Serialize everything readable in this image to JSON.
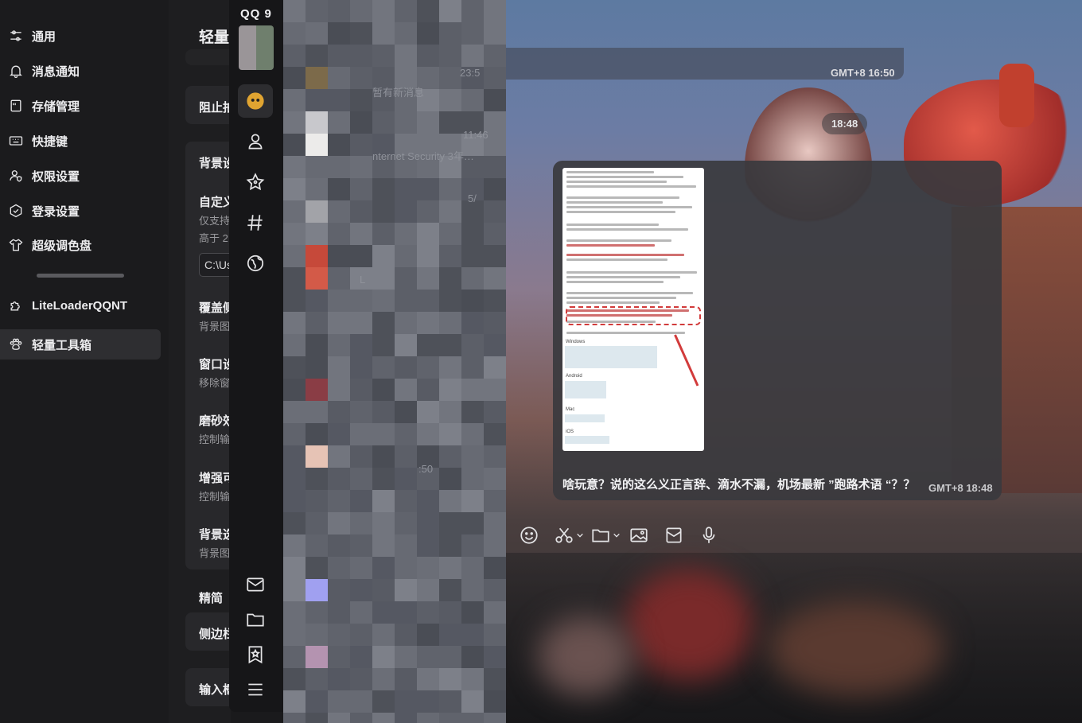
{
  "settings_nav": {
    "items": [
      {
        "label": "通用",
        "icon": "sliders-icon"
      },
      {
        "label": "消息通知",
        "icon": "bell-icon"
      },
      {
        "label": "存储管理",
        "icon": "storage-icon"
      },
      {
        "label": "快捷键",
        "icon": "keyboard-icon"
      },
      {
        "label": "权限设置",
        "icon": "user-shield-icon"
      },
      {
        "label": "登录设置",
        "icon": "hexagon-check-icon"
      },
      {
        "label": "超级调色盘",
        "icon": "shirt-icon"
      }
    ],
    "plugins": [
      {
        "label": "LiteLoaderQQNT",
        "icon": "puzzle-icon"
      },
      {
        "label": "轻量工具箱",
        "icon": "paw-icon",
        "active": true
      }
    ]
  },
  "settings_panel": {
    "title": "轻量",
    "rows": [
      {
        "title": "阻止拍"
      },
      {
        "title": "背景设"
      },
      {
        "title": "自定义",
        "sub1": "仅支持",
        "sub2": "高于 2"
      },
      {
        "path": "C:\\Us"
      },
      {
        "title": "覆盖侧",
        "sub": "背景图"
      },
      {
        "title": "窗口设",
        "sub": "移除窗"
      },
      {
        "title": "磨砂效",
        "sub": "控制输"
      },
      {
        "title": "增强可",
        "sub": "控制输"
      },
      {
        "title": "背景选",
        "sub": "背景图"
      },
      {
        "section": "精简"
      },
      {
        "title": "侧边栏"
      },
      {
        "title": "输入框"
      }
    ]
  },
  "qq_rail": {
    "logo": "QQ 9",
    "buttons": [
      "message-icon",
      "contacts-icon",
      "star-icon",
      "hashtag-icon",
      "globe-icon"
    ],
    "bottom": [
      "mail-icon",
      "folder-icon",
      "bookmark-star-icon",
      "menu-icon"
    ]
  },
  "conversation_list": {
    "fragments": [
      {
        "text": "23:5"
      },
      {
        "text": "暂有新消息"
      },
      {
        "text": "11:46"
      },
      {
        "text": "nternet Security 3年…"
      },
      {
        "text": "5/"
      },
      {
        "text": "L"
      },
      {
        "text": ":50"
      }
    ]
  },
  "chat": {
    "time_divider_1": "GMT+8 16:50",
    "time_divider_2": "18:48",
    "message_text": "啥玩意？说的这么义正言辞、滴水不漏，机场最新 ”跑路术语 “？？",
    "message_time": "GMT+8 18:48",
    "doc_os_labels": [
      "Windows",
      "Android",
      "Mac",
      "iOS"
    ]
  },
  "toolbar": {
    "tools": [
      "emoji-icon",
      "scissors-icon",
      "folder-icon",
      "image-icon",
      "red-packet-icon",
      "microphone-icon"
    ]
  }
}
